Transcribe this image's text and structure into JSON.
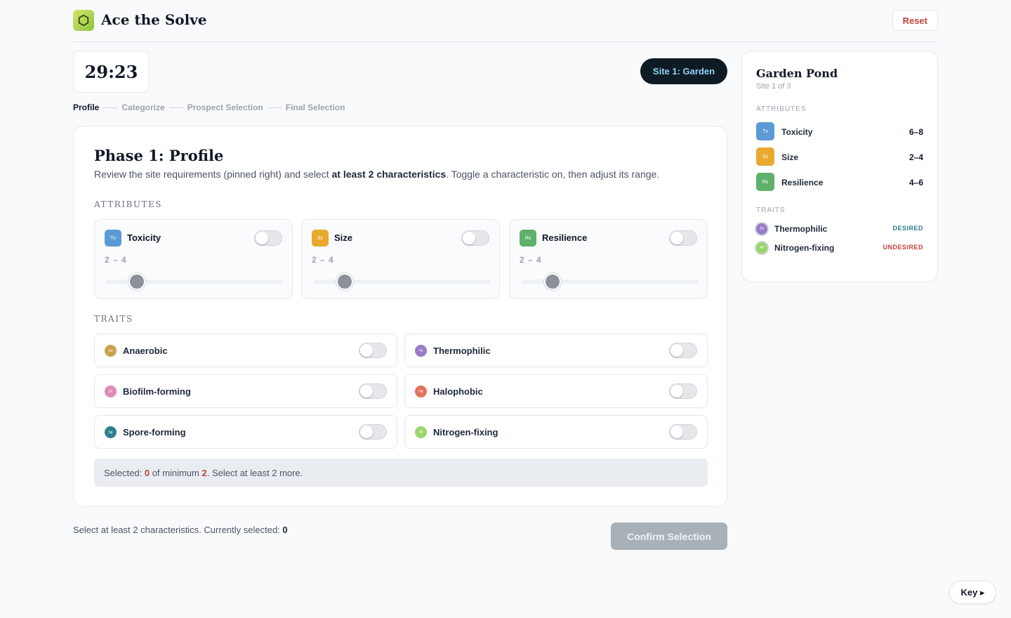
{
  "app": {
    "brand": "Ace the Solve",
    "reset_label": "Reset"
  },
  "timer": "29:23",
  "site_pill": "Site 1: Garden",
  "steps": [
    "Profile",
    "Categorize",
    "Prospect Selection",
    "Final Selection"
  ],
  "phase": {
    "title": "Phase 1: Profile",
    "desc_pre": "Review the site requirements (pinned right) and select ",
    "desc_bold": "at least 2 characteristics",
    "desc_post": ". Toggle a characteristic on, then adjust its range."
  },
  "labels": {
    "attributes": "ATTRIBUTES",
    "traits": "TRAITS"
  },
  "attributes": [
    {
      "abbr": "Tx",
      "name": "Toxicity",
      "range": "2 – 4",
      "value_low": 2,
      "value_high": 4,
      "color": "#5b9bd5",
      "enabled": false
    },
    {
      "abbr": "Sz",
      "name": "Size",
      "range": "2 – 4",
      "value_low": 2,
      "value_high": 4,
      "color": "#e9a92e",
      "enabled": false
    },
    {
      "abbr": "Rs",
      "name": "Resilience",
      "range": "2 – 4",
      "value_low": 2,
      "value_high": 4,
      "color": "#5fb06b",
      "enabled": false
    }
  ],
  "traits": [
    {
      "abbr": "An",
      "name": "Anaerobic",
      "color": "#c9a24a",
      "enabled": false
    },
    {
      "abbr": "Th",
      "name": "Thermophilic",
      "color": "#9b7cc8",
      "enabled": false
    },
    {
      "abbr": "Bf",
      "name": "Biofilm-forming",
      "color": "#de8bb6",
      "enabled": false
    },
    {
      "abbr": "Ha",
      "name": "Halophobic",
      "color": "#e2735e",
      "enabled": false
    },
    {
      "abbr": "Sp",
      "name": "Spore-forming",
      "color": "#2f7f8c",
      "enabled": false
    },
    {
      "abbr": "Nf",
      "name": "Nitrogen-fixing",
      "color": "#9ad66b",
      "enabled": false
    }
  ],
  "notice": {
    "pre": "Selected: ",
    "count": "0",
    "mid": " of minimum ",
    "min": "2",
    "post": ". Select at least 2 more."
  },
  "footer": {
    "note_pre": "Select at least 2 characteristics. Currently selected: ",
    "note_count": "0",
    "confirm_label": "Confirm Selection"
  },
  "sidebar": {
    "title": "Garden Pond",
    "subtitle": "Site 1 of 3",
    "attributes_label": "ATTRIBUTES",
    "traits_label": "TRAITS",
    "attributes": [
      {
        "abbr": "Tx",
        "name": "Toxicity",
        "value": "6–8",
        "color": "#5b9bd5"
      },
      {
        "abbr": "Sz",
        "name": "Size",
        "value": "2–4",
        "color": "#e9a92e"
      },
      {
        "abbr": "Rs",
        "name": "Resilience",
        "value": "4–6",
        "color": "#5fb06b"
      }
    ],
    "traits": [
      {
        "abbr": "Th",
        "name": "Thermophilic",
        "tag": "DESIRED",
        "color": "#9b7cc8",
        "tag_color": "#2f7f8c"
      },
      {
        "abbr": "Nf",
        "name": "Nitrogen-fixing",
        "tag": "UNDESIRED",
        "color": "#9ad66b",
        "tag_color": "#c2413b"
      }
    ]
  },
  "key_label": "Key ▸"
}
